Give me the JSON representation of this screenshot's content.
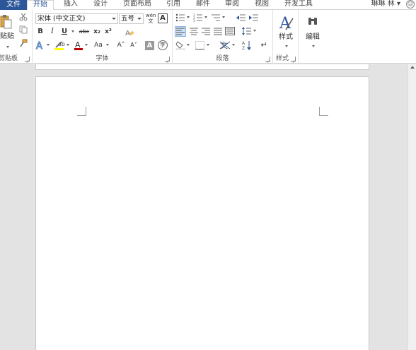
{
  "tabs": {
    "file": "文件",
    "items": [
      "开始",
      "插入",
      "设计",
      "页面布局",
      "引用",
      "邮件",
      "审阅",
      "视图",
      "开发工具"
    ]
  },
  "user": {
    "name": "琳琳 林",
    "menu_arrow": "▾"
  },
  "clipboard": {
    "paste_label": "贴贴",
    "group_label": "剪贴板"
  },
  "font": {
    "family_value": "宋体 (中文正文)",
    "size_value": "五号",
    "bold": "B",
    "italic": "I",
    "underline": "U",
    "strike": "abc",
    "subscript": "x₂",
    "superscript": "x²",
    "grow": "A˄",
    "shrink": "A˅",
    "case": "Aa",
    "phonetic": "wén",
    "char_border": "A",
    "char_shade": "A",
    "enclose": "字",
    "group_label": "字体"
  },
  "paragraph": {
    "group_label": "段落"
  },
  "styles": {
    "label": "样式",
    "group_label": "样式"
  },
  "editing": {
    "label": "编辑"
  },
  "colors": {
    "accent": "#2b579a",
    "highlight": "#ffff00",
    "font_color": "#c00000"
  }
}
